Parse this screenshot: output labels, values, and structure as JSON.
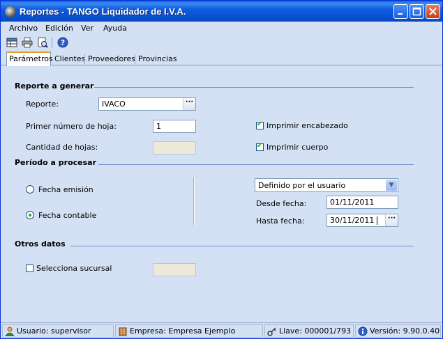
{
  "window": {
    "title": "Reportes - TANGO Liquidador de I.V.A."
  },
  "menu": {
    "items": [
      "Archivo",
      "Edición",
      "Ver",
      "Ayuda"
    ]
  },
  "toolbar": {
    "icons": [
      "grid-icon",
      "print-icon",
      "preview-icon",
      "help-icon"
    ]
  },
  "tabs": [
    {
      "label": "Parámetros",
      "active": true
    },
    {
      "label": "Clientes",
      "active": false
    },
    {
      "label": "Proveedores",
      "active": false
    },
    {
      "label": "Provincias",
      "active": false
    }
  ],
  "reporte": {
    "section_title": "Reporte a generar",
    "reporte_label": "Reporte:",
    "reporte_value": "IVACO",
    "primer_label": "Primer número de hoja:",
    "primer_value": "1",
    "cantidad_label": "Cantidad de hojas:",
    "cantidad_value": "",
    "encabezado_label": "Imprimir encabezado",
    "encabezado_checked": true,
    "cuerpo_label": "Imprimir cuerpo",
    "cuerpo_checked": true
  },
  "periodo": {
    "section_title": "Período a procesar",
    "emision_label": "Fecha emisión",
    "emision_selected": false,
    "contable_label": "Fecha contable",
    "contable_selected": true,
    "dropdown_value": "Definido por el usuario",
    "desde_label": "Desde fecha:",
    "desde_value": "01/11/2011",
    "hasta_label": "Hasta fecha:",
    "hasta_value": "30/11/2011"
  },
  "otros": {
    "section_title": "Otros datos",
    "sucursal_label": "Selecciona sucursal",
    "sucursal_checked": false,
    "sucursal_value": ""
  },
  "status": {
    "usuario": "Usuario: supervisor",
    "empresa": "Empresa: Empresa Ejemplo",
    "llave": "Llave: 000001/793",
    "version": "Versión: 9.90.0.40"
  },
  "colors": {
    "titlebar": "#0a5fd8",
    "background": "#d4e1f5",
    "accent_check": "#21a121"
  }
}
